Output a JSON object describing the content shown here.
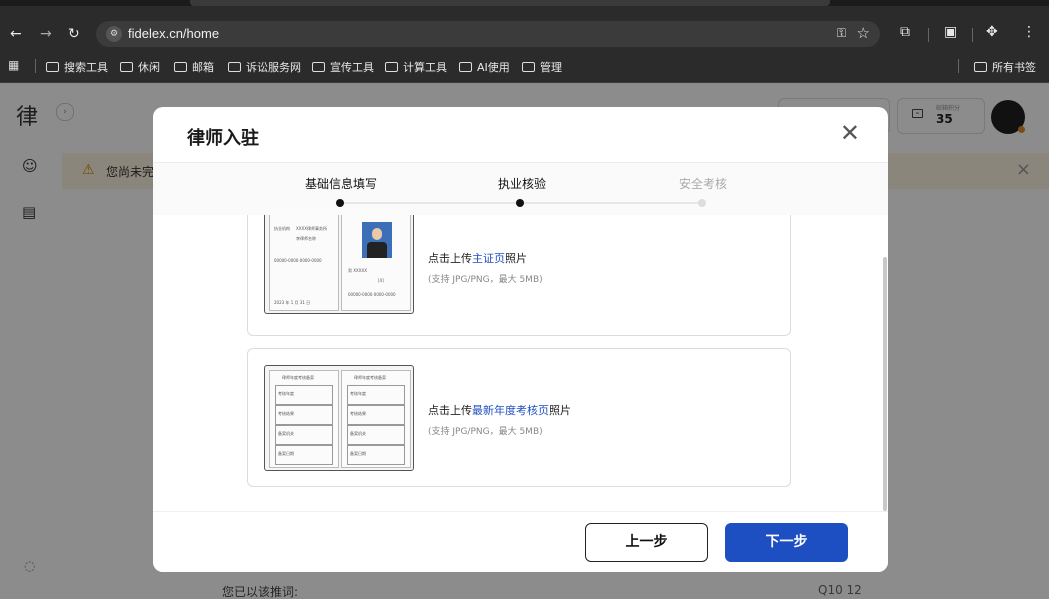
{
  "browser": {
    "url": "fidelex.cn/home",
    "bookmarks": [
      "搜索工具",
      "休闲",
      "邮箱",
      "诉讼服务网",
      "宣传工具",
      "计算工具",
      "AI使用",
      "管理"
    ],
    "all_bookmarks": "所有书签"
  },
  "app": {
    "logo": "律",
    "banner_text": "您尚未完",
    "points_label": "邮箱积分",
    "points_value": "35",
    "bottom_text": "您已以该推词:",
    "bottom_right": "Q10  12"
  },
  "modal": {
    "title": "律师入驻",
    "steps": [
      {
        "label": "基础信息填写",
        "state": "done"
      },
      {
        "label": "执业核验",
        "state": "active"
      },
      {
        "label": "安全考核",
        "state": "pending"
      }
    ],
    "cards": [
      {
        "text_prefix": "点击上传",
        "text_highlight": "主证页",
        "text_suffix": "照片",
        "hint": "(支持 JPG/PNG，最大 5MB)"
      },
      {
        "text_prefix": "点击上传",
        "text_highlight": "最新年度考核页",
        "text_suffix": "照片",
        "hint": "(支持 JPG/PNG，最大 5MB)"
      }
    ],
    "license_page": {
      "holder_label": "执业机构",
      "holder_value": "XXXX律师事务所",
      "name": "李律师名称",
      "cert_no": "00000-0000-0000-0000",
      "date": "2023 年 1 月 31 日",
      "gender": "男  XXXXX",
      "id_label": "[4]",
      "id_no": "00000-0000-0000-0000"
    },
    "annual_page": {
      "left_title": "律师年度考核备案",
      "right_title": "律师年度考核备案",
      "rows": [
        "考核年度",
        "考核结果",
        "备案机关",
        "备案日期"
      ]
    },
    "prev_label": "上一步",
    "next_label": "下一步"
  },
  "colors": {
    "accent": "#1e4fc2",
    "warning": "#d48806"
  }
}
